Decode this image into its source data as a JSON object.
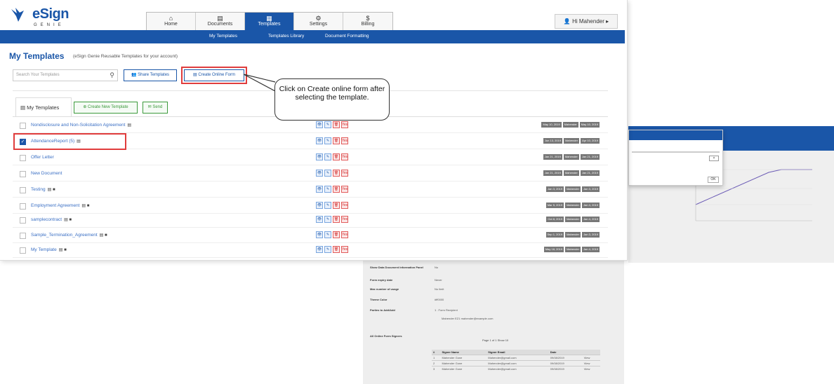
{
  "logo": {
    "brand": "eSign",
    "tagline": "GENIE"
  },
  "topnav": [
    {
      "icon": "home-icon",
      "glyph": "⌂",
      "label": "Home",
      "active": false
    },
    {
      "icon": "documents-icon",
      "glyph": "▤",
      "label": "Documents",
      "active": false
    },
    {
      "icon": "templates-icon",
      "glyph": "▦",
      "label": "Templates",
      "active": true
    },
    {
      "icon": "settings-icon",
      "glyph": "⚙",
      "label": "Settings",
      "active": false
    },
    {
      "icon": "billing-icon",
      "glyph": "$",
      "label": "Billing",
      "active": false
    }
  ],
  "user": {
    "label": "Hi Mahender ▸"
  },
  "subnav": [
    "My Templates",
    "Templates Library",
    "Document Formatting"
  ],
  "page": {
    "title": "My Templates",
    "subtitle": "(eSign Genie Reusable Templates for your account)"
  },
  "toolbar": {
    "search_placeholder": "Search Your Templates",
    "share_label": "Share Templates",
    "online_label": "Create Online Form"
  },
  "tabs": {
    "my_templates": "My Templates",
    "create_new": "Create New Template",
    "send": "Send"
  },
  "templates": [
    {
      "name": "Nondisclosure and Non-Solicitation Agreement",
      "icons": "▤",
      "checked": false,
      "dates": [
        "May 10, 2019",
        "Mahender",
        "May 10, 2019"
      ]
    },
    {
      "name": "AttendanceReport (5)",
      "icons": "▤",
      "checked": true,
      "dates": [
        "Jun 13, 2019",
        "Mahender",
        "Apr 10, 2019"
      ]
    },
    {
      "name": "Offer Letter",
      "icons": "",
      "checked": false,
      "dates": [
        "Jan 21, 2019",
        "Mahender",
        "Jan 21, 2019"
      ]
    },
    {
      "name": "New Document",
      "icons": "",
      "checked": false,
      "dates": [
        "Jan 21, 2019",
        "Mahender",
        "Jan 21, 2019"
      ]
    },
    {
      "name": "Testing",
      "icons": "▤ ■",
      "checked": false,
      "dates": [
        "Jan 3, 2019",
        "Mahender",
        "Jan 3, 2019"
      ]
    },
    {
      "name": "Employment Agreement",
      "icons": "▤ ■",
      "checked": false,
      "dates": [
        "Mar 5, 2019",
        "Mahender",
        "Jan 4, 2019"
      ]
    },
    {
      "name": "samplecontract",
      "icons": "▤ ■",
      "checked": false,
      "dates": [
        "Oct 8, 2019",
        "Mahender",
        "Jan 4, 2019"
      ]
    },
    {
      "name": "Sample_Termination_Agreement",
      "icons": "▤ ■",
      "checked": false,
      "dates": [
        "Sep 1, 2019",
        "Mahender",
        "Jan 3, 2019"
      ]
    },
    {
      "name": "My Template",
      "icons": "▤ ■",
      "checked": false,
      "dates": [
        "May 18, 2019",
        "Mahender",
        "Jan 4, 2019"
      ]
    }
  ],
  "row_actions": [
    "👁",
    "✎",
    "🗑",
    "Yes"
  ],
  "callout": {
    "text": "Click on Create online form after selecting the template."
  },
  "background_detail": {
    "rows": [
      {
        "label": "Show Data Document Information Panel",
        "value": "No"
      },
      {
        "label": "Form expiry date",
        "value": "Never"
      },
      {
        "label": "Max number of usage",
        "value": "No limit"
      },
      {
        "label": "Theme Color",
        "value": "#ff0000"
      },
      {
        "label": "Parties to Add/Add",
        "value": "1 . Form Recipient"
      },
      {
        "label": "",
        "value": "Mahender EZ1 mahender@example.com"
      },
      {
        "label": "All Online Form Signers",
        "value": ""
      }
    ],
    "pager": "Page 1 of 1  Show 10",
    "table_headers": [
      "#",
      "Signer Name",
      "Signer Email",
      "Date",
      ""
    ],
    "table_rows": [
      [
        "1",
        "Mahender Gone",
        "Mahender@gmail.com",
        "09/08/2019",
        "View"
      ],
      [
        "2",
        "Mahender Gone",
        "Mahender@gmail.com",
        "09/08/2019",
        "View"
      ],
      [
        "3",
        "Mahender Gone",
        "Mahender@gmail.com",
        "09/08/2019",
        "View"
      ]
    ]
  }
}
